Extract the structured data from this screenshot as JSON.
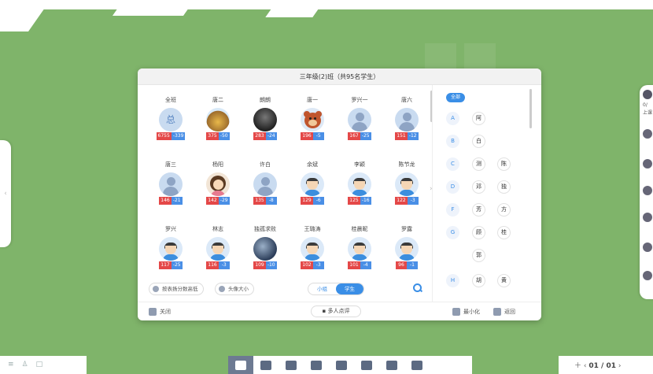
{
  "dialog": {
    "title": "三年级(2)班（共95名学生）"
  },
  "students": [
    {
      "name": "全班",
      "avatar": "total",
      "avatar_text": "总",
      "plus": "6755",
      "minus": "-339"
    },
    {
      "name": "唐二",
      "avatar": "food",
      "plus": "375",
      "minus": "-50"
    },
    {
      "name": "朗朗",
      "avatar": "dark",
      "plus": "283",
      "minus": "-24"
    },
    {
      "name": "唐一",
      "avatar": "bear",
      "plus": "196",
      "minus": "-5"
    },
    {
      "name": "罗兴一",
      "avatar": "gray",
      "plus": "167",
      "minus": "-25"
    },
    {
      "name": "唐六",
      "avatar": "gray",
      "plus": "151",
      "minus": "-12"
    },
    {
      "name": "唐三",
      "avatar": "gray",
      "plus": "146",
      "minus": "-21"
    },
    {
      "name": "杨阳",
      "avatar": "girl",
      "plus": "142",
      "minus": "-29"
    },
    {
      "name": "许白",
      "avatar": "gray",
      "plus": "135",
      "minus": "-8"
    },
    {
      "name": "余斌",
      "avatar": "cartoon",
      "plus": "129",
      "minus": "-6"
    },
    {
      "name": "李颖",
      "avatar": "cartoon",
      "plus": "125",
      "minus": "-16"
    },
    {
      "name": "陈节龙",
      "avatar": "cartoon",
      "plus": "122",
      "minus": "-3"
    },
    {
      "name": "罗兴",
      "avatar": "cartoon",
      "plus": "117",
      "minus": "-25"
    },
    {
      "name": "林志",
      "avatar": "cartoon",
      "plus": "116",
      "minus": "-3"
    },
    {
      "name": "独孤求败",
      "avatar": "fantasy",
      "plus": "109",
      "minus": "-10"
    },
    {
      "name": "王璐涛",
      "avatar": "cartoon",
      "plus": "102",
      "minus": "-3"
    },
    {
      "name": "桂晨昵",
      "avatar": "cartoon",
      "plus": "101",
      "minus": "-4"
    },
    {
      "name": "罗露",
      "avatar": "cartoon",
      "plus": "96",
      "minus": "-1"
    }
  ],
  "tools": {
    "sort_label": "按表扬分数高低",
    "avatar_size_label": "头像大小",
    "seg_group": "小组",
    "seg_student": "学生"
  },
  "footer": {
    "close_label": "关闭",
    "multi_review_label": "多人点评",
    "minimize_label": "最小化",
    "back_label": "返回"
  },
  "alphabet": {
    "all_label": "全部",
    "rows": [
      {
        "letter": "A",
        "chars": [
          "阿"
        ]
      },
      {
        "letter": "B",
        "chars": [
          "白"
        ]
      },
      {
        "letter": "C",
        "chars": [
          "测",
          "陈"
        ]
      },
      {
        "letter": "D",
        "chars": [
          "邓",
          "独"
        ]
      },
      {
        "letter": "F",
        "chars": [
          "芳",
          "方"
        ]
      },
      {
        "letter": "G",
        "chars": [
          "顾",
          "桂"
        ]
      },
      {
        "letter": "",
        "chars": [
          "郭"
        ]
      },
      {
        "letter": "H",
        "chars": [
          "胡",
          "黄"
        ]
      }
    ]
  },
  "right_panel": {
    "count": "0/",
    "label": "上课"
  },
  "bottom": {
    "page": "01 / 01"
  },
  "colors": {
    "background": "#7fb46a",
    "accent": "#3a8ee6",
    "plus": "#e44848",
    "minus": "#4a8fe6"
  }
}
